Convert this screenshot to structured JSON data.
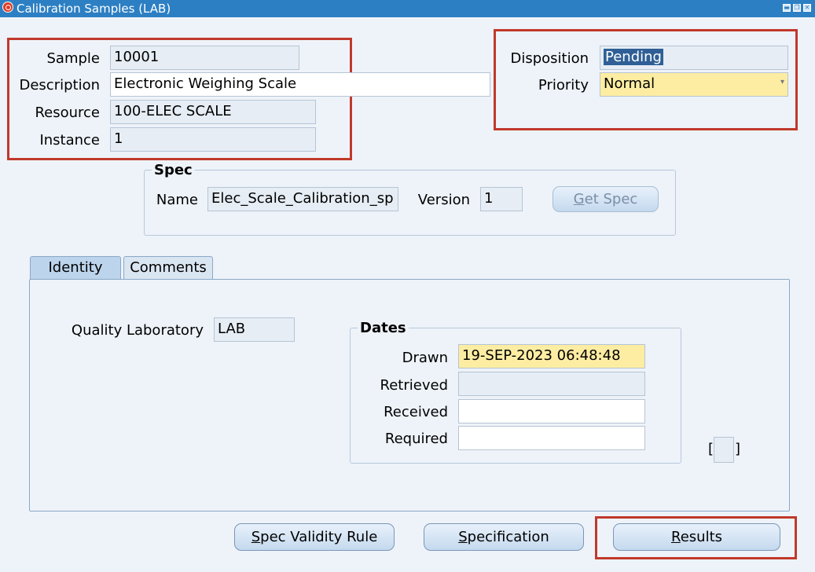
{
  "window": {
    "title": "Calibration Samples (LAB)",
    "controls": [
      "▬",
      "❐",
      "✕"
    ]
  },
  "header": {
    "sample": {
      "label": "Sample",
      "value": "10001"
    },
    "description": {
      "label": "Description",
      "value": "Electronic Weighing Scale"
    },
    "resource": {
      "label": "Resource",
      "value": "100-ELEC SCALE"
    },
    "instance": {
      "label": "Instance",
      "value": "1"
    },
    "disposition": {
      "label": "Disposition",
      "value": "Pending"
    },
    "priority": {
      "label": "Priority",
      "value": "Normal"
    }
  },
  "spec": {
    "title": "Spec",
    "name_label": "Name",
    "name_value": "Elec_Scale_Calibration_sp",
    "version_label": "Version",
    "version_value": "1",
    "get_spec": {
      "prefix": "G",
      "rest": "et Spec"
    }
  },
  "tabs": [
    "Identity",
    "Comments"
  ],
  "identity": {
    "quality_lab_label": "Quality Laboratory",
    "quality_lab_value": "LAB",
    "dates": {
      "title": "Dates",
      "drawn_label": "Drawn",
      "drawn_value": "19-SEP-2023 06:48:48",
      "retrieved_label": "Retrieved",
      "retrieved_value": "",
      "received_label": "Received",
      "received_value": "",
      "required_label": "Required",
      "required_value": ""
    },
    "flex_left": "[",
    "flex_right": "]"
  },
  "buttons": {
    "spec_validity": {
      "prefix": "S",
      "rest": "pec Validity Rule"
    },
    "specification": {
      "prefix": "S",
      "rest": "pecification"
    },
    "results": {
      "prefix": "R",
      "rest": "esults"
    }
  },
  "colors": {
    "titlebar": "#2c7fc3",
    "highlight": "#c0392b",
    "required_field": "#fdeda3",
    "selection": "#2f5f96"
  }
}
